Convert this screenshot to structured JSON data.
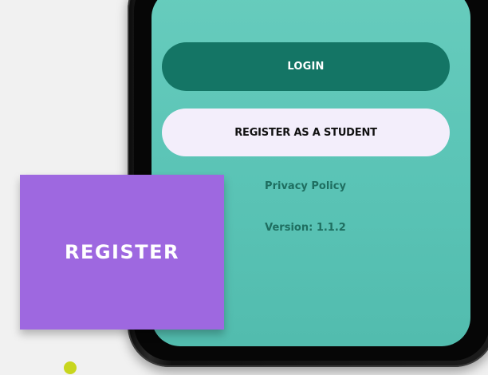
{
  "app": {
    "login_label": "LOGIN",
    "register_label": "REGISTER AS A STUDENT",
    "privacy_policy_label": "Privacy Policy",
    "version_text": "Version: 1.1.2"
  },
  "overlay": {
    "title": "REGISTER"
  },
  "colors": {
    "background": "#f1f1f1",
    "screen_teal": "#5cc5b7",
    "login_button": "#147565",
    "register_button": "#f3eefb",
    "link_text": "#1e6e60",
    "overlay_purple": "#9e68e0",
    "accent_dot": "#c8d61e"
  }
}
